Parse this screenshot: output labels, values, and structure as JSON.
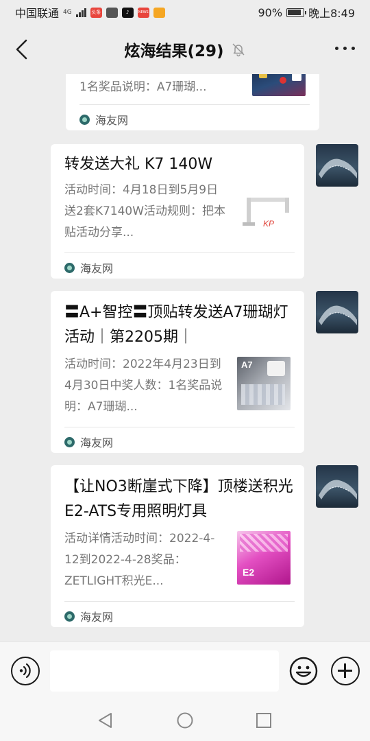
{
  "status": {
    "carrier": "中国联通",
    "network": "4G",
    "battery": "90%",
    "time": "晚上8:49",
    "apps": [
      {
        "name": "toutiao",
        "label": "头条",
        "color": "#e8453c"
      },
      {
        "name": "mail",
        "label": "",
        "color": "#555555"
      },
      {
        "name": "tiktok",
        "label": "",
        "color": "#111111"
      },
      {
        "name": "news",
        "label": "NEWS",
        "color": "#e8453c"
      },
      {
        "name": "shop",
        "label": "",
        "color": "#f5a623"
      }
    ]
  },
  "nav": {
    "title": "炫海结果(29)"
  },
  "messages": [
    {
      "desc": "1名奖品说明：A7珊瑚...",
      "source": "海友网"
    },
    {
      "title": "转发送大礼 K7 140W",
      "desc": "活动时间：4月18日到5月9日送2套K7140W活动规则：把本贴活动分享...",
      "source": "海友网"
    },
    {
      "title": "〓A+智控〓顶贴转发送A7珊瑚灯活动｜第2205期｜",
      "desc": "活动时间：2022年4月23日到4月30日中奖人数：1名奖品说明：A7珊瑚...",
      "source": "海友网"
    },
    {
      "title": "【让NO3断崖式下降】顶楼送积光E2-ATS专用照明灯具",
      "desc": "活动详情活动时间：2022-4-12到2022-4-28奖品：ZETLIGHT积光E...",
      "source": "海友网"
    }
  ],
  "colors": {
    "background": "#ededed",
    "card": "#ffffff",
    "muted_text": "#777777"
  }
}
